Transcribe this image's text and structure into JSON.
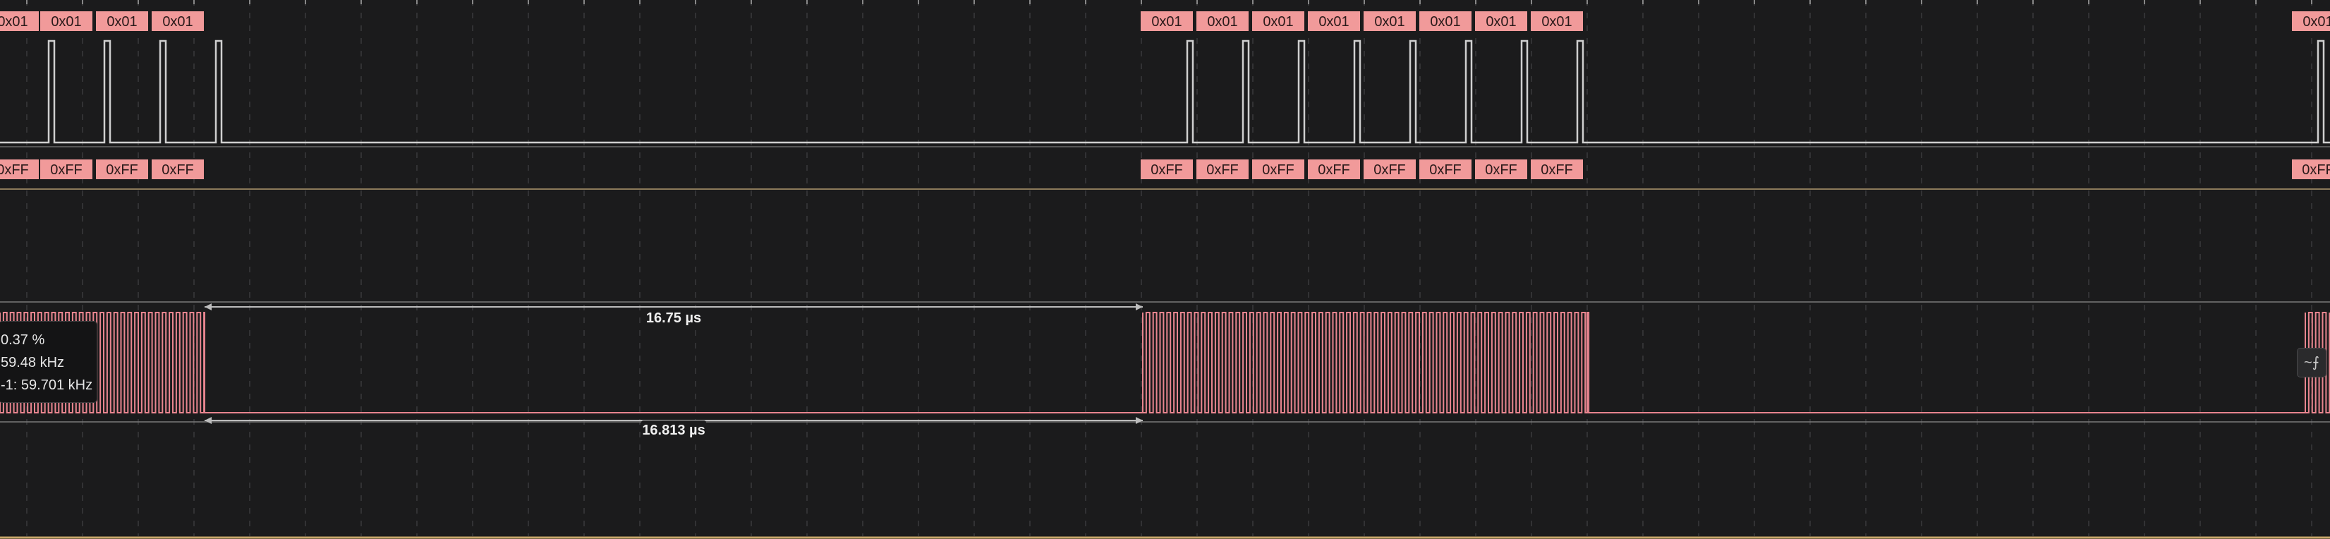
{
  "row1": {
    "labels_left": [
      "0x01",
      "0x01",
      "0x01",
      "0x01"
    ],
    "labels_mid": [
      "0x01",
      "0x01",
      "0x01",
      "0x01",
      "0x01",
      "0x01",
      "0x01",
      "0x01"
    ],
    "labels_right": [
      "0x01"
    ]
  },
  "row2": {
    "labels_left": [
      "0xFF",
      "0xFF",
      "0xFF",
      "0xFF"
    ],
    "labels_mid": [
      "0xFF",
      "0xFF",
      "0xFF",
      "0xFF",
      "0xFF",
      "0xFF",
      "0xFF",
      "0xFF"
    ],
    "labels_right": [
      "0xFF"
    ]
  },
  "measure": {
    "width_upper": "16.75 µs",
    "period_lower": "16.813 µs"
  },
  "tooltip": {
    "line1": "0.37 %",
    "line2": "59.48 kHz",
    "line3": "-1: 59.701 kHz"
  },
  "colors": {
    "background": "#1b1b1c",
    "grid": "#3a3a3c",
    "digital_trace": "#cfcfcf",
    "pwm_trace": "#e8858f",
    "label_fill": "#f19a9a",
    "measure_line": "#bdbdbd",
    "bottom_bar": "#c9a86a"
  },
  "icons": {
    "trigger_control": "wave-trigger-icon"
  }
}
